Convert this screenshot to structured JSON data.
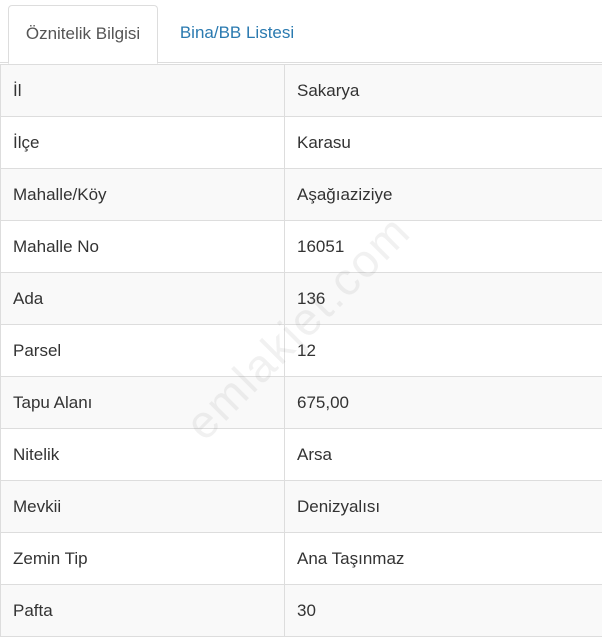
{
  "tabs": [
    {
      "label": "Öznitelik Bilgisi",
      "active": true
    },
    {
      "label": "Bina/BB Listesi",
      "active": false
    }
  ],
  "rows": [
    {
      "key": "İl",
      "value": "Sakarya"
    },
    {
      "key": "İlçe",
      "value": "Karasu"
    },
    {
      "key": "Mahalle/Köy",
      "value": "Aşağıaziziye"
    },
    {
      "key": "Mahalle No",
      "value": "16051"
    },
    {
      "key": "Ada",
      "value": "136"
    },
    {
      "key": "Parsel",
      "value": "12"
    },
    {
      "key": "Tapu Alanı",
      "value": "675,00"
    },
    {
      "key": "Nitelik",
      "value": "Arsa"
    },
    {
      "key": "Mevkii",
      "value": "Denizyalısı"
    },
    {
      "key": "Zemin Tip",
      "value": "Ana Taşınmaz"
    },
    {
      "key": "Pafta",
      "value": "30"
    }
  ],
  "watermark": "emlakjet.com",
  "colors": {
    "tab_link": "#2a7ab0",
    "border": "#dddddd",
    "stripe": "#f9f9f9"
  }
}
